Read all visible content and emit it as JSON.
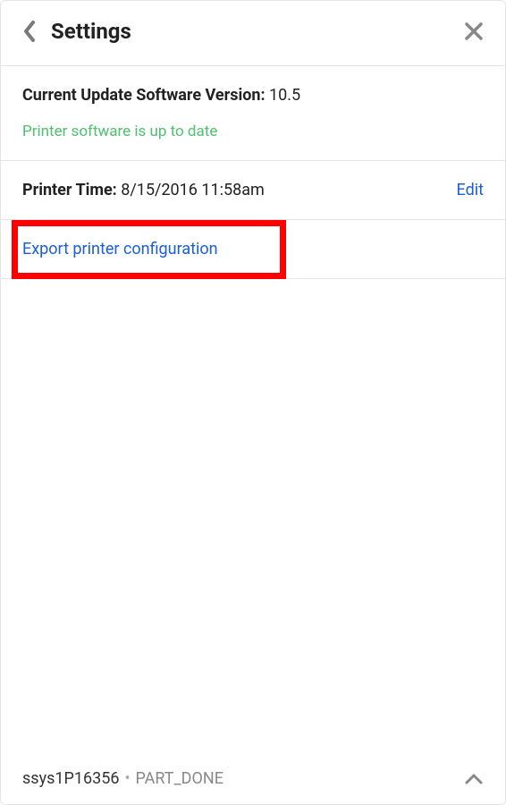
{
  "header": {
    "title": "Settings"
  },
  "version": {
    "label": "Current Update Software Version:",
    "value": "10.5",
    "status": "Printer software is up to date"
  },
  "time": {
    "label": "Printer Time:",
    "value": "8/15/2016 11:58am",
    "edit_label": "Edit"
  },
  "export": {
    "link_label": "Export printer configuration"
  },
  "footer": {
    "id": "ssys1P16356",
    "status": "PART_DONE"
  }
}
